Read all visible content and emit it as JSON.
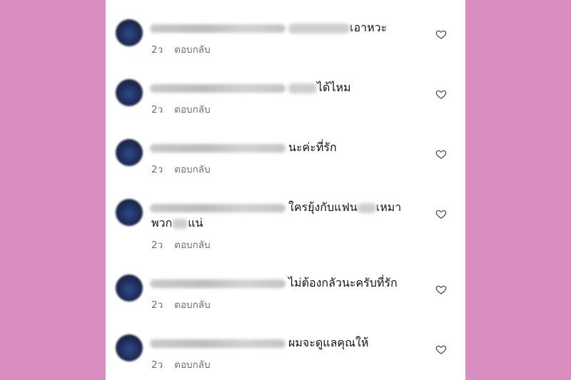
{
  "background_color": "#d88fbf",
  "comments": [
    {
      "text": "เอาหวะ",
      "time": "2ว",
      "reply": "ตอบกลับ"
    },
    {
      "text": "ได้ไหม",
      "time": "2ว",
      "reply": "ตอบกลับ"
    },
    {
      "text": "นะค่ะที่รัก",
      "time": "2ว",
      "reply": "ตอบกลับ"
    },
    {
      "text": "ใครยุ้งกับแฟน",
      "text_b": "เหมา",
      "text_line2_a": "พวก",
      "text_line2_b": "แน่",
      "time": "2ว",
      "reply": "ตอบกลับ"
    },
    {
      "text": "ไม่ต้องกลัวนะครับที่รัก",
      "time": "2ว",
      "reply": "ตอบกลับ"
    },
    {
      "text": "ผมจะดูแลคุณให้",
      "time": "2ว",
      "reply": "ตอบกลับ"
    }
  ],
  "icons": {
    "like": "heart-outline-icon"
  }
}
